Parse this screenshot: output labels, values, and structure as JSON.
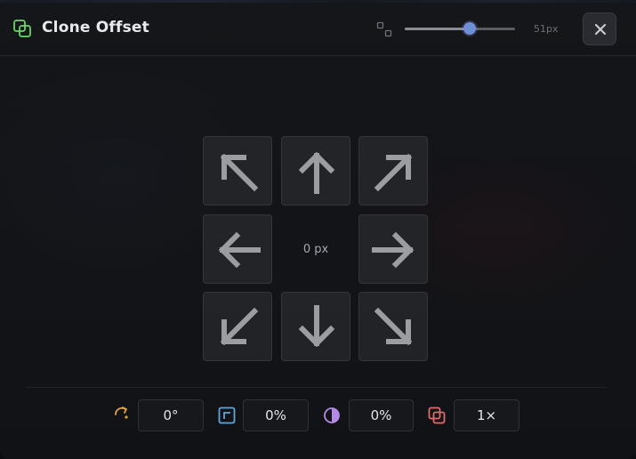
{
  "dialog": {
    "title": "Clone Offset",
    "size_value": "51px",
    "size_slider_fraction": 0.59,
    "accent": "#6f8fd6",
    "close_icon": "close-icon"
  },
  "direction_pad": {
    "center_label": "0 px",
    "buttons": [
      "up-left",
      "up",
      "up-right",
      "left",
      "right",
      "down-left",
      "down",
      "down-right"
    ]
  },
  "footer": {
    "rotation_value": "0°",
    "scale_value": "0%",
    "opacity_value": "0%",
    "count_value": "1×",
    "rotation_icon_color": "#e8a537",
    "scale_icon_color": "#5aa8de",
    "opacity_icon_color": "#b58ae6",
    "count_icon_color": "#e36a6a",
    "title_icon_color": "#6ed36a"
  }
}
